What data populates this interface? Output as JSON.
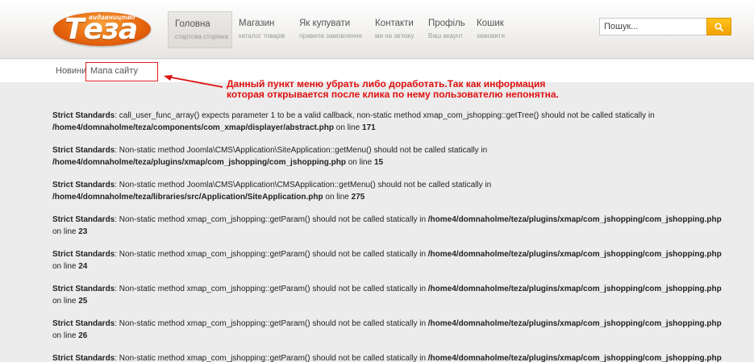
{
  "logo": {
    "top_text": "видавництво",
    "main_text": "Теза"
  },
  "nav": [
    {
      "title": "Головна",
      "sub": "стартова сторінка",
      "active": true
    },
    {
      "title": "Магазин",
      "sub": "каталог товарів"
    },
    {
      "title": "Як купувати",
      "sub": "правила замовлення"
    },
    {
      "title": "Контакти",
      "sub": "ми на зв'язку"
    },
    {
      "title": "Профіль",
      "sub": "Ваш акаунт"
    },
    {
      "title": "Кошик",
      "sub": "замовити"
    }
  ],
  "search": {
    "placeholder": "Пошук...",
    "icon": "search-icon"
  },
  "breadcrumb": {
    "item1": "Новини",
    "item2": "Мапа сайту"
  },
  "annotation": {
    "line1": "Данный пункт меню убрать либо доработать.Так как информация",
    "line2": "которая открывается  после клика по нему пользователю непонятна."
  },
  "errors": [
    {
      "label": "Strict Standards",
      "msg": ": call_user_func_array() expects parameter 1 to be a valid callback, non-static method xmap_com_jshopping::getTree() should not be called statically in",
      "path": "/home4/domnaholme/teza/components/com_xmap/displayer/abstract.php",
      "online": " on line ",
      "line": "171"
    },
    {
      "label": "Strict Standards",
      "msg": ": Non-static method Joomla\\CMS\\Application\\SiteApplication::getMenu() should not be called statically in",
      "path": "/home4/domnaholme/teza/plugins/xmap/com_jshopping/com_jshopping.php",
      "online": " on line ",
      "line": "15"
    },
    {
      "label": "Strict Standards",
      "msg": ": Non-static method Joomla\\CMS\\Application\\CMSApplication::getMenu() should not be called statically in",
      "path": "/home4/domnaholme/teza/libraries/src/Application/SiteApplication.php",
      "online": " on line ",
      "line": "275"
    },
    {
      "label": "Strict Standards",
      "msg": ": Non-static method xmap_com_jshopping::getParam() should not be called statically in ",
      "path": "/home4/domnaholme/teza/plugins/xmap/com_jshopping/com_jshopping.php",
      "online": "on line ",
      "line": "23"
    },
    {
      "label": "Strict Standards",
      "msg": ": Non-static method xmap_com_jshopping::getParam() should not be called statically in ",
      "path": "/home4/domnaholme/teza/plugins/xmap/com_jshopping/com_jshopping.php",
      "online": "on line ",
      "line": "24"
    },
    {
      "label": "Strict Standards",
      "msg": ": Non-static method xmap_com_jshopping::getParam() should not be called statically in ",
      "path": "/home4/domnaholme/teza/plugins/xmap/com_jshopping/com_jshopping.php",
      "online": "on line ",
      "line": "25"
    },
    {
      "label": "Strict Standards",
      "msg": ": Non-static method xmap_com_jshopping::getParam() should not be called statically in ",
      "path": "/home4/domnaholme/teza/plugins/xmap/com_jshopping/com_jshopping.php",
      "online": "on line ",
      "line": "26"
    },
    {
      "label": "Strict Standards",
      "msg": ": Non-static method xmap_com_jshopping::getParam() should not be called statically in ",
      "path": "/home4/domnaholme/teza/plugins/xmap/com_jshopping/com_jshopping.php",
      "online": "",
      "line": ""
    }
  ],
  "colors": {
    "accent": "#e5630c",
    "search_button": "#f2a200",
    "annotation": "#e01010"
  }
}
